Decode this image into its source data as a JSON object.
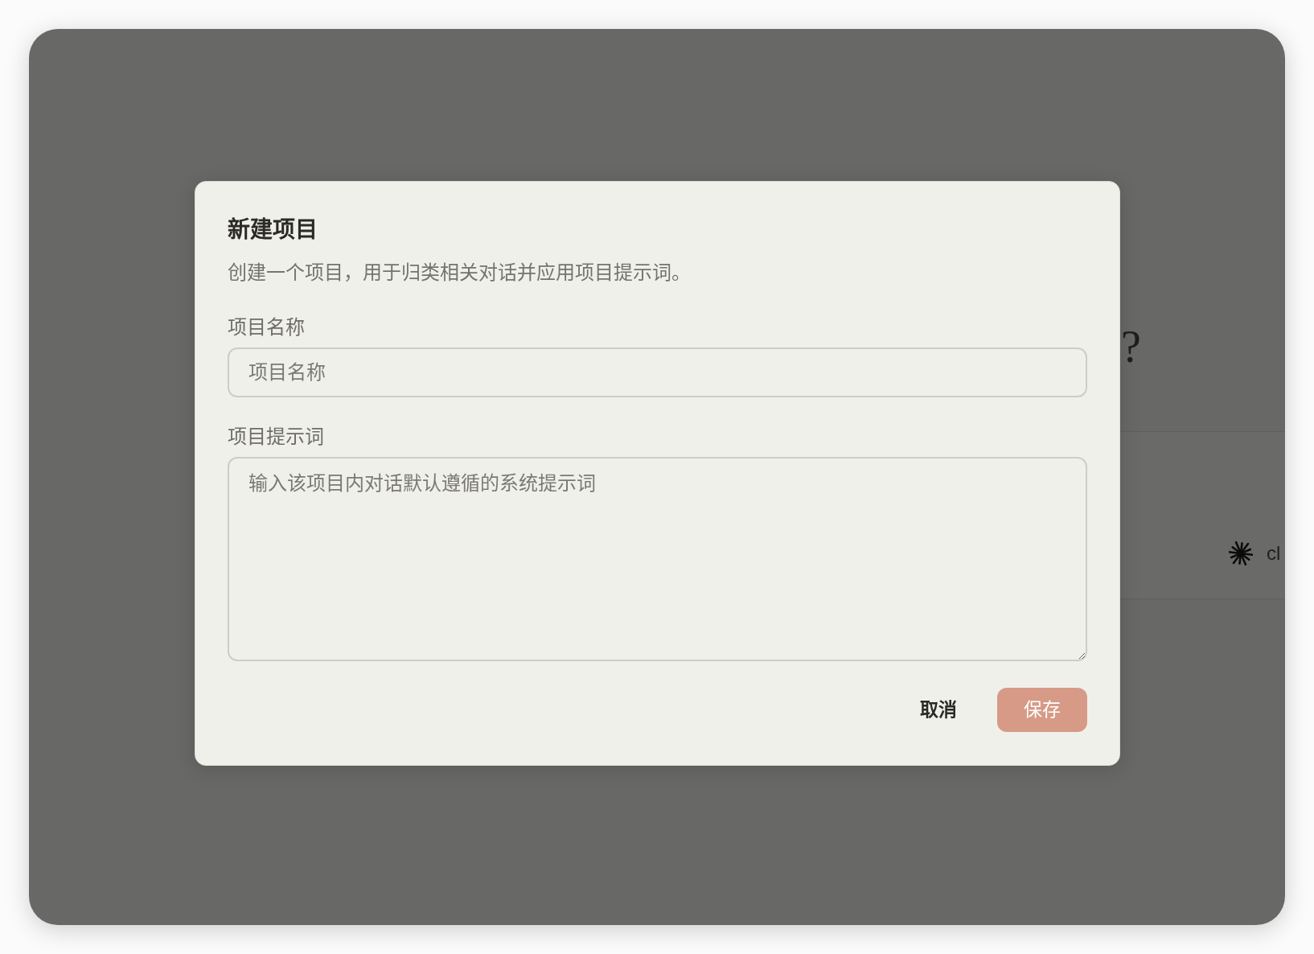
{
  "background": {
    "heading_end": "?",
    "card": {
      "label": "cl"
    }
  },
  "dialog": {
    "title": "新建项目",
    "description": "创建一个项目，用于归类相关对话并应用项目提示词。",
    "fields": [
      {
        "kind": "input",
        "label": "项目名称",
        "placeholder": "项目名称"
      },
      {
        "kind": "textarea",
        "label": "项目提示词",
        "placeholder": "输入该项目内对话默认遵循的系统提示词"
      }
    ],
    "buttons": [
      {
        "kind": "text",
        "label": "取消",
        "disabled": false
      },
      {
        "kind": "primary",
        "label": "保存",
        "disabled": true
      }
    ]
  }
}
